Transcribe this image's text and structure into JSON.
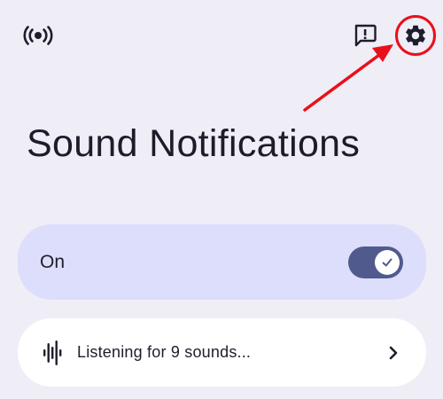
{
  "header": {
    "left_icon": "live-broadcast-icon",
    "right_icons": [
      "feedback-icon",
      "settings-gear-icon"
    ],
    "highlight_color": "#e8101a"
  },
  "page": {
    "title": "Sound Notifications"
  },
  "main_toggle": {
    "label": "On",
    "state": "on",
    "accent_color": "#515a8c"
  },
  "listening_row": {
    "icon": "audio-waveform-icon",
    "label": "Listening for 9 sounds...",
    "trailing_icon": "chevron-right-icon"
  }
}
